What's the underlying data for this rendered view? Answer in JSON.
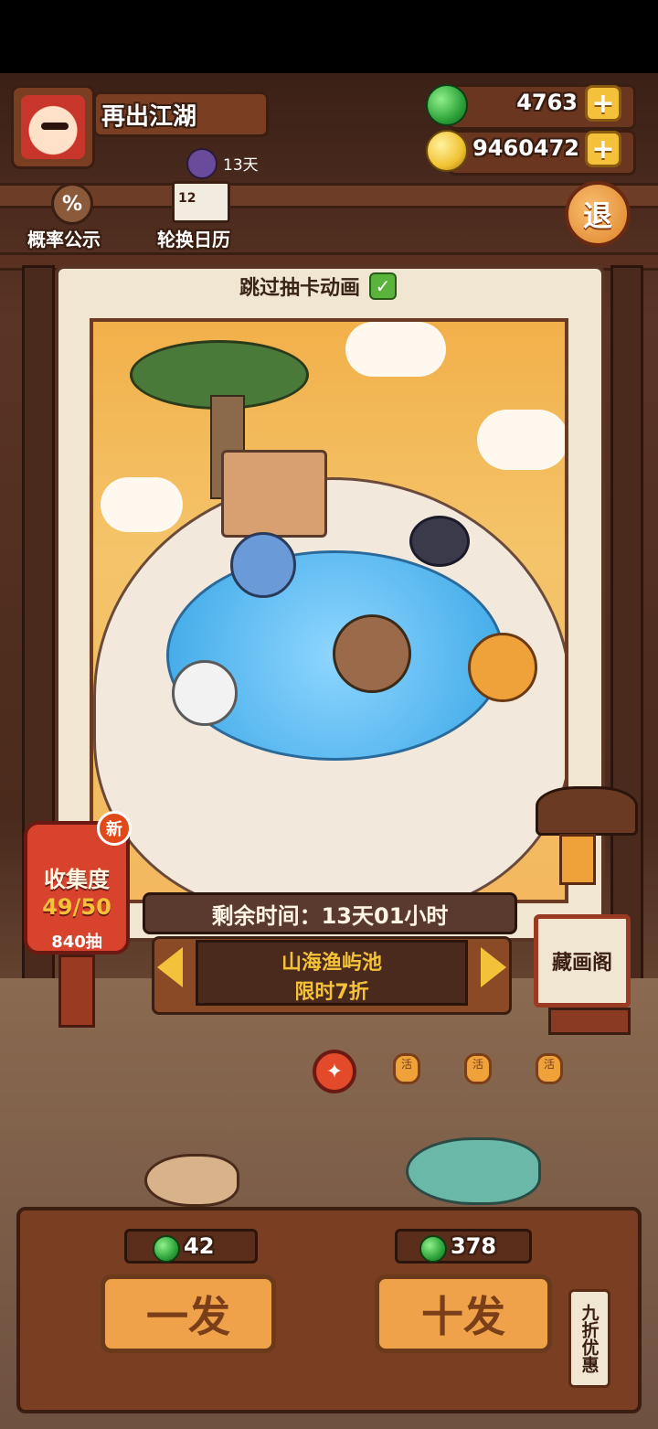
{
  "player": {
    "name": "再出江湖",
    "buff_days": "13天"
  },
  "currency": {
    "jade": "4763",
    "coins": "9460472",
    "plus": "+"
  },
  "top_actions": {
    "probability": "概率公示",
    "probability_icon": "%",
    "calendar": "轮换日历",
    "calendar_icon": "12",
    "exit": "退"
  },
  "card": {
    "skip_label": "跳过抽卡动画",
    "skip_checked": true
  },
  "collection": {
    "badge": "新",
    "title": "收集度",
    "progress": "49/50",
    "pulls": "840抽"
  },
  "pool": {
    "timer": "剩余时间：13天01小时",
    "name": "山海渔屿池",
    "discount": "限时7折",
    "gallery": "藏画阁"
  },
  "pager": {
    "active_index": 0,
    "count": 4,
    "inactive_glyph": "活"
  },
  "pulls": {
    "single": {
      "label": "一发",
      "cost": "42"
    },
    "ten": {
      "label": "十发",
      "cost": "378"
    },
    "discount_tag": "九折优惠"
  },
  "colors": {
    "jade": "#2ea33a",
    "gold": "#f4c23a",
    "wood": "#7a3e22",
    "button": "#f0a24a"
  }
}
